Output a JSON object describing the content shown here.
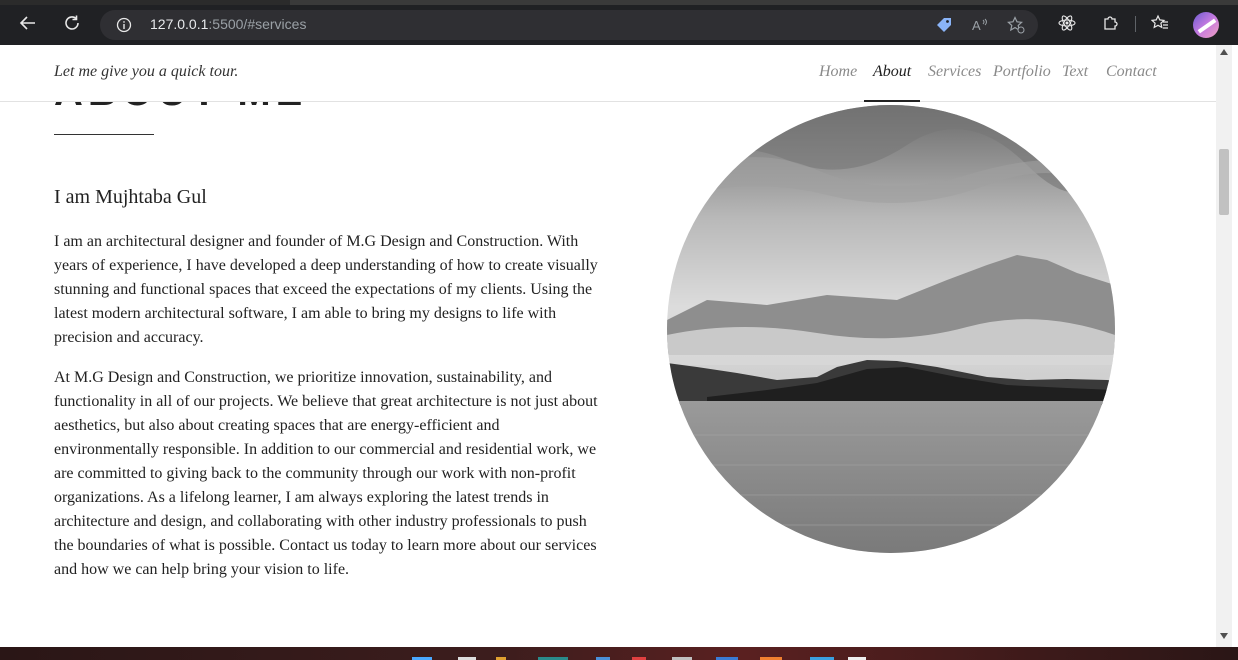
{
  "browser": {
    "url_host": "127.0.0.1",
    "url_rest": ":5500/#services",
    "icons": [
      "back-arrow-icon",
      "refresh-icon",
      "info-icon",
      "tag-icon",
      "read-aloud-icon",
      "favorite-add-icon",
      "react-devtools-icon",
      "extensions-icon",
      "favorites-icon",
      "profile-avatar"
    ]
  },
  "header": {
    "tagline": "Let me give you a quick tour.",
    "menu": [
      {
        "label": "Home"
      },
      {
        "label": "About"
      },
      {
        "label": "Services"
      },
      {
        "label": "Portfolio"
      },
      {
        "label": "Text"
      },
      {
        "label": "Contact"
      }
    ],
    "active": "About"
  },
  "about": {
    "title": "ABOUT ME",
    "heading": "I am Mujhtaba Gul",
    "para1": "I am an architectural designer and founder of M.G Design and Construction. With years of experience, I have developed a deep understanding of how to create visually stunning and functional spaces that exceed the expectations of my clients. Using the latest modern architectural software, I am able to bring my designs to life with precision and accuracy.",
    "para2": "At M.G Design and Construction, we prioritize innovation, sustainability, and functionality in all of our projects. We believe that great architecture is not just about aesthetics, but also about creating spaces that are energy-efficient and environmentally responsible. In addition to our commercial and residential work, we are committed to giving back to the community through our work with non-profit organizations. As a lifelong learner, I am always exploring the latest trends in architecture and design, and collaborating with other industry professionals to push the boundaries of what is possible. Contact us today to learn more about our services and how we can help bring your vision to life."
  },
  "colors": {
    "chrome_bg": "#202124",
    "address_bg": "#2f2f33",
    "text": "#222222",
    "menu_inactive": "#8a8a8a"
  }
}
